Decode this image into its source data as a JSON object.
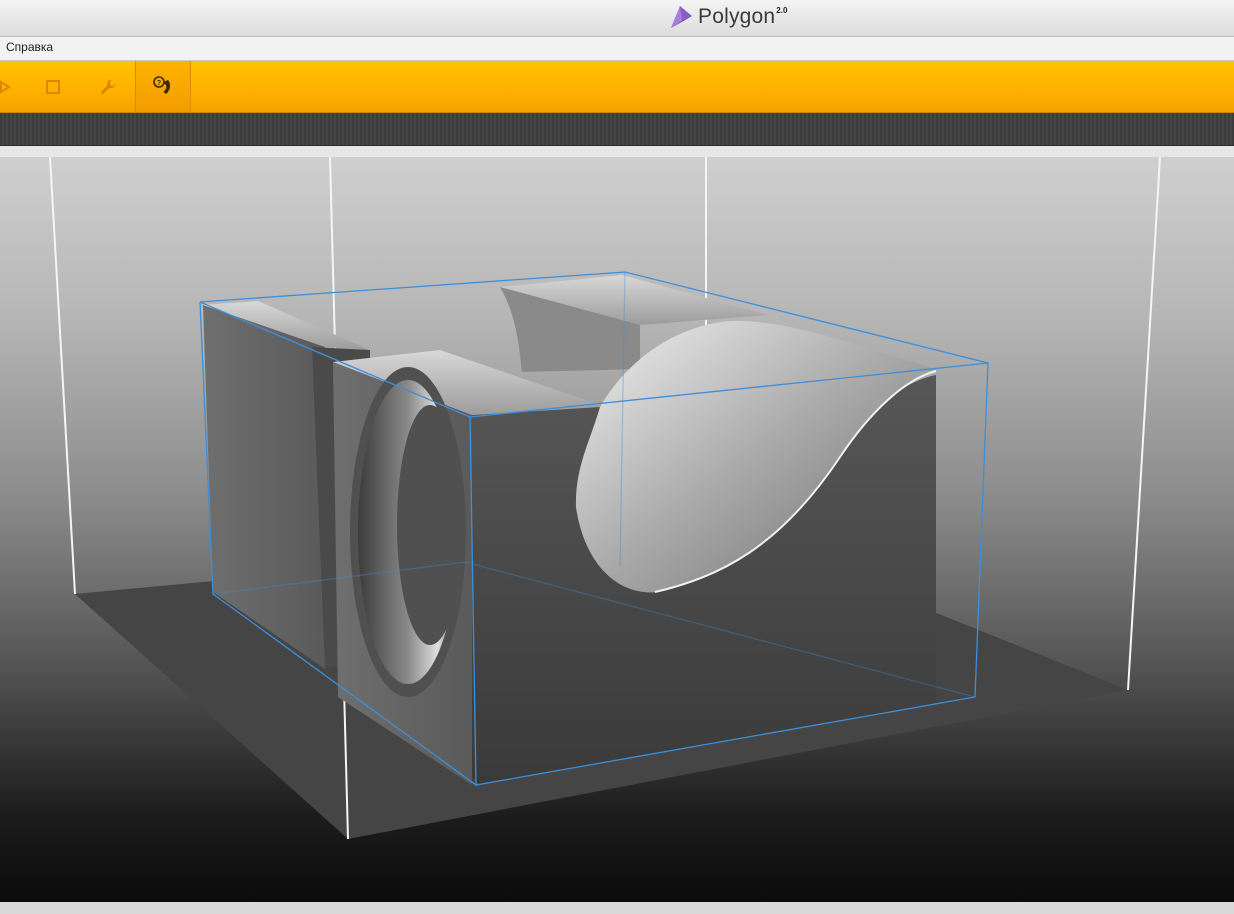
{
  "app": {
    "name": "Polygon",
    "version": "2.0"
  },
  "menu": {
    "items": [
      {
        "label": "Справка"
      }
    ]
  },
  "toolbar": {
    "tools": [
      {
        "icon": "play-arrow-icon"
      },
      {
        "icon": "square-icon"
      },
      {
        "icon": "wrench-icon"
      },
      {
        "icon": "support-phone-icon",
        "active": true
      }
    ]
  },
  "colors": {
    "toolbar_accent": "#ffb400",
    "logo_purple": "#7a4bb0",
    "bounding_box": "#3d8fd9"
  }
}
